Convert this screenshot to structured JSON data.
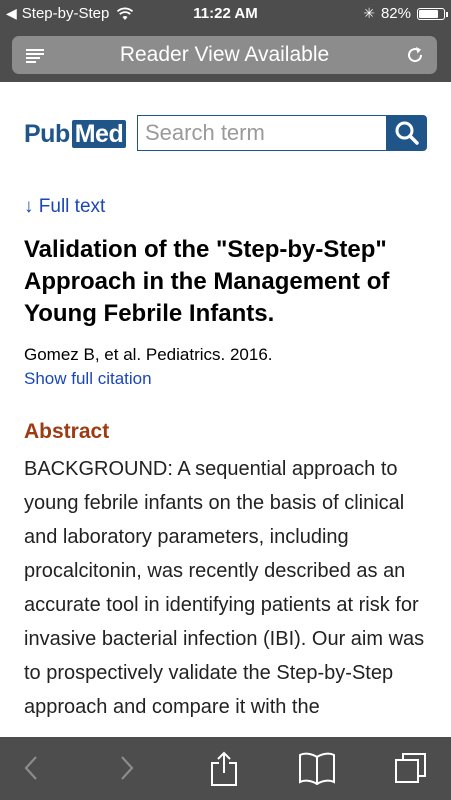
{
  "status_bar": {
    "back_label": "Step-by-Step",
    "time": "11:22 AM",
    "battery": "82%",
    "battery_level": 0.82
  },
  "url_bar": {
    "text": "Reader View Available"
  },
  "pubmed": {
    "logo_pub": "Pub",
    "logo_med": "Med",
    "search_placeholder": "Search term"
  },
  "article": {
    "full_text_link": "↓ Full text",
    "title": "Validation of the \"Step-by-Step\" Approach in the Management of Young Febrile Infants.",
    "citation": "Gomez B, et al. Pediatrics. 2016.",
    "show_citation": "Show full citation",
    "abstract_heading": "Abstract",
    "abstract_text": "BACKGROUND: A sequential approach to young febrile infants on the basis of clinical and laboratory parameters, including procalcitonin, was recently described as an accurate tool in identifying patients at risk for invasive bacterial infection (IBI). Our aim was to prospectively validate the Step-by-Step approach and compare it with the"
  }
}
